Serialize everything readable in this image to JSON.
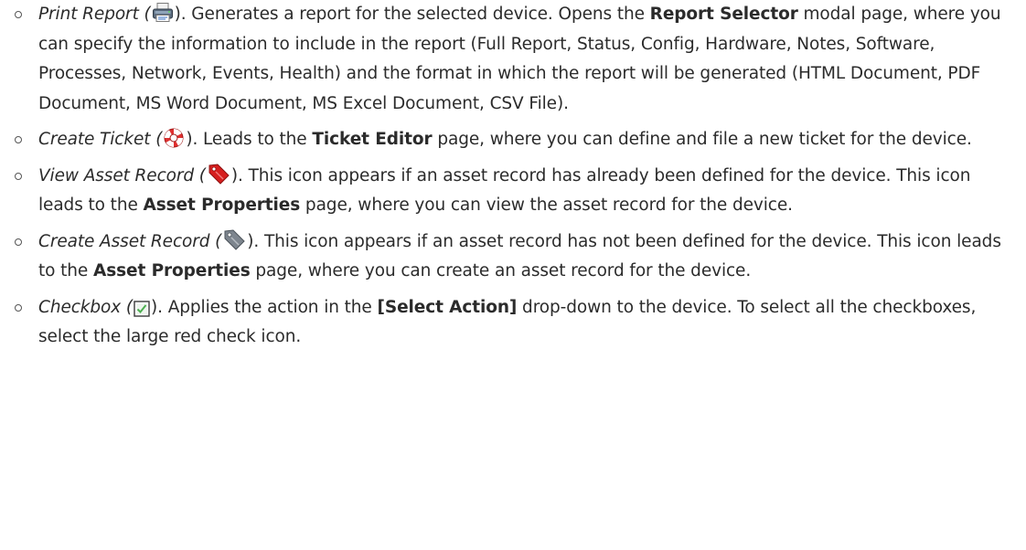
{
  "items": [
    {
      "term": "Print Report (",
      "icon": "printer-icon",
      "after_icon": "). Generates a report for the selected device. Opens the ",
      "strong1": "Report Selector",
      "rest": " modal page, where you can specify the information to include in the report (Full Report, Status, Config, Hardware, Notes, Software, Processes, Network, Events, Health) and the format in which the report will be generated (HTML Document, PDF Document, MS Word Document, MS Excel Document, CSV File)."
    },
    {
      "term": "Create Ticket (",
      "icon": "lifebuoy-icon",
      "after_icon": "). Leads to the ",
      "strong1": "Ticket Editor",
      "rest": " page, where you can define and file a new ticket for the device."
    },
    {
      "term": "View Asset Record (",
      "icon": "red-tag-icon",
      "after_icon": "). This icon appears if an asset record has already been defined for the device. This icon leads to the ",
      "strong1": "Asset Properties",
      "rest": " page, where you can view the asset record for the device."
    },
    {
      "term": "Create Asset Record (",
      "icon": "gray-tag-icon",
      "after_icon": "). This icon appears if an asset record has not been defined for the device. This icon leads to the ",
      "strong1": "Asset Properties",
      "rest": " page, where you can create an asset record for the device."
    },
    {
      "term": "Checkbox (",
      "icon": "checkbox-icon",
      "after_icon": "). Applies the action in the ",
      "strong1": "[Select Action]",
      "rest": " drop-down to the device. To select all the checkboxes, select the large red check icon."
    }
  ]
}
